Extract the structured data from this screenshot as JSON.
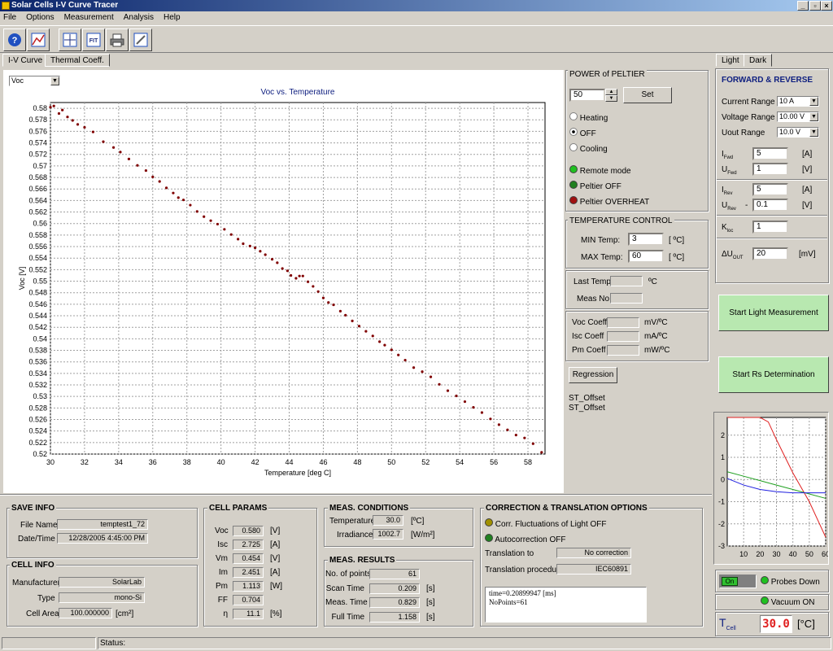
{
  "window": {
    "title": "Solar Cells I-V Curve Tracer"
  },
  "menu": [
    "File",
    "Options",
    "Measurement",
    "Analysis",
    "Help"
  ],
  "toolbar_icons": [
    "help-icon",
    "plot-icon",
    "crosshair-icon",
    "fit-icon",
    "printer-icon",
    "edit-icon"
  ],
  "toolbar_fit_label": "FIT",
  "tabs": {
    "main": [
      "I-V Curve",
      "Thermal Coeff."
    ],
    "right": [
      "Light",
      "Dark"
    ]
  },
  "plot_select": "Voc",
  "chart_data": [
    {
      "type": "scatter",
      "title": "Voc vs. Temperature",
      "xlabel": "Temperature [deg C]",
      "ylabel": "Voc [V]",
      "xlim": [
        30,
        59
      ],
      "ylim": [
        0.52,
        0.581
      ],
      "x_ticks": [
        "30",
        "32",
        "34",
        "36",
        "38",
        "40",
        "42",
        "44",
        "46",
        "48",
        "50",
        "52",
        "54",
        "56",
        "58"
      ],
      "y_ticks": [
        "0.58",
        "0.578",
        "0.576",
        "0.574",
        "0.572",
        "0.57",
        "0.568",
        "0.566",
        "0.564",
        "0.562",
        "0.56",
        "0.558",
        "0.556",
        "0.554",
        "0.552",
        "0.55",
        "0.548",
        "0.546",
        "0.544",
        "0.542",
        "0.54",
        "0.538",
        "0.536",
        "0.534",
        "0.532",
        "0.53",
        "0.528",
        "0.526",
        "0.524",
        "0.522",
        "0.52"
      ],
      "grid": true,
      "series": [
        {
          "color": "#800000",
          "x": [
            30.0,
            30.2,
            30.5,
            30.7,
            31.0,
            31.3,
            31.6,
            32.0,
            32.5,
            33.1,
            33.7,
            34.1,
            34.6,
            35.1,
            35.6,
            36.0,
            36.4,
            36.8,
            37.2,
            37.5,
            37.8,
            38.2,
            38.6,
            39.0,
            39.4,
            39.8,
            40.2,
            40.6,
            41.0,
            41.3,
            41.7,
            42.0,
            42.3,
            42.6,
            43.0,
            43.3,
            43.6,
            43.9,
            44.1,
            44.4,
            44.6,
            44.8,
            45.1,
            45.4,
            45.7,
            46.0,
            46.3,
            46.6,
            47.0,
            47.3,
            47.7,
            48.1,
            48.5,
            48.9,
            49.3,
            49.6,
            50.0,
            50.4,
            50.8,
            51.3,
            51.8,
            52.3,
            52.8,
            53.3,
            53.8,
            54.3,
            54.8,
            55.3,
            55.8,
            56.3,
            56.8,
            57.3,
            57.8,
            58.3,
            58.8
          ],
          "y": [
            0.5802,
            0.5804,
            0.5791,
            0.5797,
            0.5785,
            0.5779,
            0.5772,
            0.5767,
            0.5759,
            0.5742,
            0.5732,
            0.5724,
            0.5712,
            0.5701,
            0.5692,
            0.5681,
            0.5673,
            0.5662,
            0.5653,
            0.5645,
            0.5641,
            0.5632,
            0.5621,
            0.5612,
            0.5605,
            0.5599,
            0.559,
            0.5581,
            0.5573,
            0.5565,
            0.5561,
            0.5558,
            0.5552,
            0.5546,
            0.5538,
            0.5532,
            0.5522,
            0.5518,
            0.551,
            0.5505,
            0.5509,
            0.5509,
            0.5499,
            0.5491,
            0.5482,
            0.5471,
            0.5463,
            0.5459,
            0.5448,
            0.5441,
            0.5431,
            0.5422,
            0.5413,
            0.5405,
            0.5395,
            0.5389,
            0.5381,
            0.5372,
            0.5363,
            0.535,
            0.5343,
            0.5334,
            0.5321,
            0.531,
            0.5301,
            0.5291,
            0.5281,
            0.5272,
            0.5261,
            0.5251,
            0.5242,
            0.5233,
            0.5228,
            0.5218,
            0.5203
          ]
        }
      ]
    },
    {
      "type": "line",
      "x_ticks": [
        "10",
        "20",
        "30",
        "40",
        "50",
        "60"
      ],
      "y_ticks": [
        "2",
        "1",
        "0",
        "-1",
        "-2",
        "-3"
      ],
      "xlim": [
        0,
        60
      ],
      "ylim": [
        -3,
        2.8
      ],
      "grid": true,
      "series": [
        {
          "color": "#e02020",
          "x": [
            0,
            10,
            20,
            25,
            30,
            40,
            50,
            60
          ],
          "y": [
            2.8,
            2.8,
            2.8,
            2.6,
            1.8,
            0.3,
            -1.0,
            -2.6
          ]
        },
        {
          "color": "#20a020",
          "x": [
            0,
            10,
            20,
            30,
            40,
            50,
            60
          ],
          "y": [
            0.35,
            0.15,
            -0.05,
            -0.25,
            -0.45,
            -0.65,
            -0.85
          ]
        },
        {
          "color": "#2020e0",
          "x": [
            0,
            10,
            20,
            30,
            40,
            50,
            60
          ],
          "y": [
            0.05,
            -0.25,
            -0.45,
            -0.55,
            -0.6,
            -0.6,
            -0.6
          ]
        }
      ]
    }
  ],
  "peltier": {
    "title": "POWER of PELTIER",
    "value": "50",
    "set_label": "Set",
    "modes": [
      "Heating",
      "OFF",
      "Cooling"
    ],
    "selected": "OFF",
    "indicators": [
      {
        "label": "Remote mode",
        "color": "#20c020"
      },
      {
        "label": "Peltier OFF",
        "color": "#208020"
      },
      {
        "label": "Peltier OVERHEAT",
        "color": "#a01010"
      }
    ]
  },
  "temp_control": {
    "title": "TEMPERATURE CONTROL",
    "min_label": "MIN Temp:",
    "min_value": "3",
    "unit": "[ ºC]",
    "max_label": "MAX Temp:",
    "max_value": "60",
    "last_temp_label": "Last Temp",
    "last_temp_unit": "ºC",
    "meas_no_label": "Meas No"
  },
  "coeffs": [
    {
      "label": "Voc Coeff",
      "unit": "mV/ºC"
    },
    {
      "label": "Isc Coeff",
      "unit": "mA/ºC"
    },
    {
      "label": "Pm Coeff",
      "unit": "mW/ºC"
    }
  ],
  "regression_label": "Regression",
  "offsets": [
    "ST_Offset",
    "ST_Offset"
  ],
  "forward_reverse": {
    "title": "FORWARD & REVERSE",
    "current_range_label": "Current Range",
    "current_range": "10 A",
    "voltage_range_label": "Voltage Range",
    "voltage_range": "10.00 V",
    "uout_range_label": "Uout Range",
    "uout_range": "10.0 V",
    "i_fwd": {
      "sym": "I",
      "sub": "Fwd",
      "value": "5",
      "unit": "[A]"
    },
    "u_fwd": {
      "sym": "U",
      "sub": "Fwd",
      "value": "1",
      "unit": "[V]"
    },
    "i_rev": {
      "sym": "I",
      "sub": "Rev",
      "value": "5",
      "unit": "[A]"
    },
    "u_rev": {
      "sym": "U",
      "sub": "Rev",
      "value": "0.1",
      "unit": "[V]",
      "prefix": "-"
    },
    "k_loc": {
      "sym": "K",
      "sub": "loc",
      "value": "1"
    },
    "du_out": {
      "sym": "ΔU",
      "sub": "OUT",
      "value": "20",
      "unit": "[mV]"
    }
  },
  "start_light": "Start Light Measurement",
  "start_rs": "Start Rs Determination",
  "probe": {
    "switch": "On",
    "probes": "Probes Down",
    "vacuum": "Vacuum ON"
  },
  "tcell": {
    "sym": "T",
    "sub": "Cell",
    "value": "30.0",
    "unit": "[°C]"
  },
  "save_info": {
    "title": "SAVE INFO",
    "file_name_label": "File Name",
    "file_name": "temptest1_72",
    "date_label": "Date/Time",
    "date": "12/28/2005 4:45:00 PM"
  },
  "cell_info": {
    "title": "CELL INFO",
    "manufacturer_label": "Manufacturer",
    "manufacturer": "SolarLab",
    "type_label": "Type",
    "type": "mono-Si",
    "area_label": "Cell Area",
    "area": "100.000000",
    "area_unit": "[cm²]"
  },
  "cell_params": {
    "title": "CELL PARAMS",
    "rows": [
      {
        "label": "Voc",
        "value": "0.580",
        "unit": "[V]"
      },
      {
        "label": "Isc",
        "value": "2.725",
        "unit": "[A]"
      },
      {
        "label": "Vm",
        "value": "0.454",
        "unit": "[V]"
      },
      {
        "label": "Im",
        "value": "2.451",
        "unit": "[A]"
      },
      {
        "label": "Pm",
        "value": "1.113",
        "unit": "[W]"
      },
      {
        "label": "FF",
        "value": "0.704",
        "unit": ""
      },
      {
        "label": "η",
        "value": "11.1",
        "unit": "[%]"
      }
    ]
  },
  "meas_conditions": {
    "title": "MEAS. CONDITIONS",
    "temp_label": "Temperature",
    "temp": "30.0",
    "temp_unit": "[ºC]",
    "irr_label": "Irradiance",
    "irr": "1002.7",
    "irr_unit": "[W/m²]"
  },
  "meas_results": {
    "title": "MEAS. RESULTS",
    "rows": [
      {
        "label": "No. of points",
        "value": "61",
        "unit": ""
      },
      {
        "label": "Scan Time",
        "value": "0.209",
        "unit": "[s]"
      },
      {
        "label": "Meas. Time",
        "value": "0.829",
        "unit": "[s]"
      },
      {
        "label": "Full Time",
        "value": "1.158",
        "unit": "[s]"
      }
    ]
  },
  "correction": {
    "title": "CORRECTION & TRANSLATION OPTIONS",
    "corr_label": "Corr. Fluctuations of Light OFF",
    "corr_color": "#a09000",
    "auto_label": "Autocorrection OFF",
    "auto_color": "#208020",
    "translation_to_label": "Translation to",
    "translation_to": "No correction",
    "procedure_label": "Translation procedure",
    "procedure": "IEC60891",
    "log_lines": [
      "time=0.20899947 [ms]",
      "NoPoints=61"
    ]
  },
  "status": {
    "label": "Status:"
  }
}
